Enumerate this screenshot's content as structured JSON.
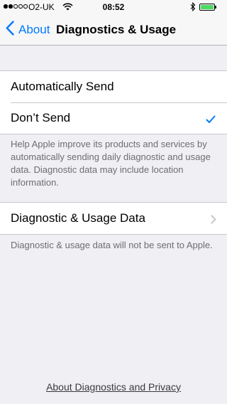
{
  "status_bar": {
    "carrier": "O2-UK",
    "time": "08:52",
    "signal_bars": 2,
    "battery_level": 1.0,
    "battery_color": "#4cd964"
  },
  "nav": {
    "back_label": "About",
    "title": "Diagnostics & Usage",
    "accent_color": "#007aff"
  },
  "send_options": {
    "items": [
      {
        "label": "Automatically Send",
        "selected": false
      },
      {
        "label": "Don’t Send",
        "selected": true
      }
    ],
    "footer": "Help Apple improve its products and services by automatically sending daily diagnostic and usage data. Diagnostic data may include location information."
  },
  "data_section": {
    "item_label": "Diagnostic & Usage Data",
    "footer": "Diagnostic & usage data will not be sent to Apple."
  },
  "privacy_link": "About Diagnostics and Privacy",
  "icons": {
    "back": "chevron-left-icon",
    "check": "checkmark-icon",
    "disclosure": "chevron-right-icon",
    "wifi": "wifi-icon",
    "bluetooth": "bluetooth-icon",
    "battery": "battery-icon"
  }
}
